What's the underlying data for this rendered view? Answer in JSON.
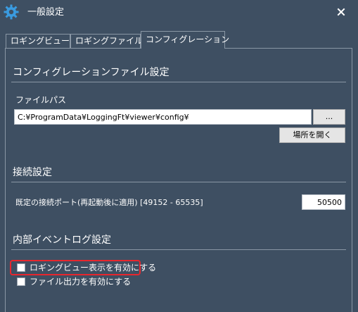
{
  "window": {
    "title": "一般設定",
    "app_icon": "gear-icon",
    "close_icon": "close-icon"
  },
  "tabs": [
    {
      "label": "ロギングビュー",
      "active": false
    },
    {
      "label": "ロギングファイル",
      "active": false
    },
    {
      "label": "コンフィグレーション",
      "active": true
    }
  ],
  "config_section": {
    "title": "コンフィグレーションファイル設定",
    "path_label": "ファイルパス",
    "path_value": "C:¥ProgramData¥LoggingFt¥viewer¥config¥",
    "browse_button": "...",
    "open_location_button": "場所を開く"
  },
  "connection_section": {
    "title": "接続設定",
    "port_label": "既定の接続ポート(再起動後に適用) [49152 - 65535]",
    "port_value": "50500"
  },
  "event_log_section": {
    "title": "内部イベントログ設定",
    "checkboxes": [
      {
        "label": "ロギングビュー表示を有効にする",
        "checked": false,
        "highlighted": true
      },
      {
        "label": "ファイル出力を有効にする",
        "checked": false,
        "highlighted": false
      }
    ]
  },
  "colors": {
    "background": "#3e4f62",
    "text": "#ffffff",
    "highlight_border": "#e8262d",
    "app_icon": "#3a9be0"
  }
}
